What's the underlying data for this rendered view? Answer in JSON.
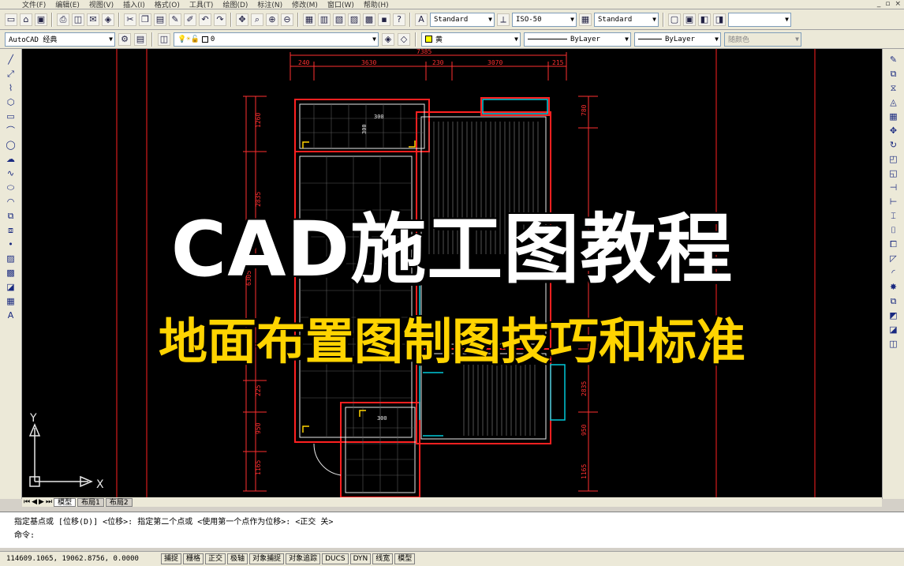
{
  "menu": [
    "文件(F)",
    "编辑(E)",
    "视图(V)",
    "插入(I)",
    "格式(O)",
    "工具(T)",
    "绘图(D)",
    "标注(N)",
    "修改(M)",
    "窗口(W)",
    "帮助(H)"
  ],
  "toolbar": {
    "text_style": "Standard",
    "dim_style": "ISO-50",
    "table_style": "Standard",
    "workspace": "AutoCAD 经典",
    "layer": "0",
    "color": "黄",
    "linetype": "ByLayer",
    "lineweight": "ByLayer",
    "plotstyle": "随颜色"
  },
  "drawing": {
    "dims_top": [
      "240",
      "3630",
      "230",
      "3070",
      "215"
    ],
    "dim_total": "7385",
    "dims_left": [
      "1260",
      "2835",
      "6305",
      "225",
      "950",
      "1165"
    ],
    "dims_right": [
      "780",
      "2835",
      "950",
      "1165"
    ],
    "room_labels": [
      "300",
      "300",
      "300"
    ]
  },
  "ucs": {
    "x_label": "X",
    "y_label": "Y"
  },
  "overlay": {
    "title": "CAD施工图教程",
    "subtitle": "地面布置图制图技巧和标准"
  },
  "tabs": [
    "模型",
    "布局1",
    "布局2"
  ],
  "command": {
    "history": "指定基点或 [位移(D)] <位移>:  指定第二个点或 <使用第一个点作为位移>:  <正交 关>",
    "prompt": "命令:"
  },
  "status": {
    "coords": "114609.1065, 19062.8756, 0.0000",
    "buttons": [
      "捕捉",
      "栅格",
      "正交",
      "极轴",
      "对象捕捉",
      "对象追踪",
      "DUCS",
      "DYN",
      "线宽",
      "模型"
    ]
  },
  "colors": {
    "canvas": "#000000",
    "title": "#ffffff",
    "subtitle": "#ffd400",
    "wall": "#ff2020",
    "dim": "#ff3030",
    "plan": "#ffffff",
    "cyan": "#00c8d8"
  }
}
